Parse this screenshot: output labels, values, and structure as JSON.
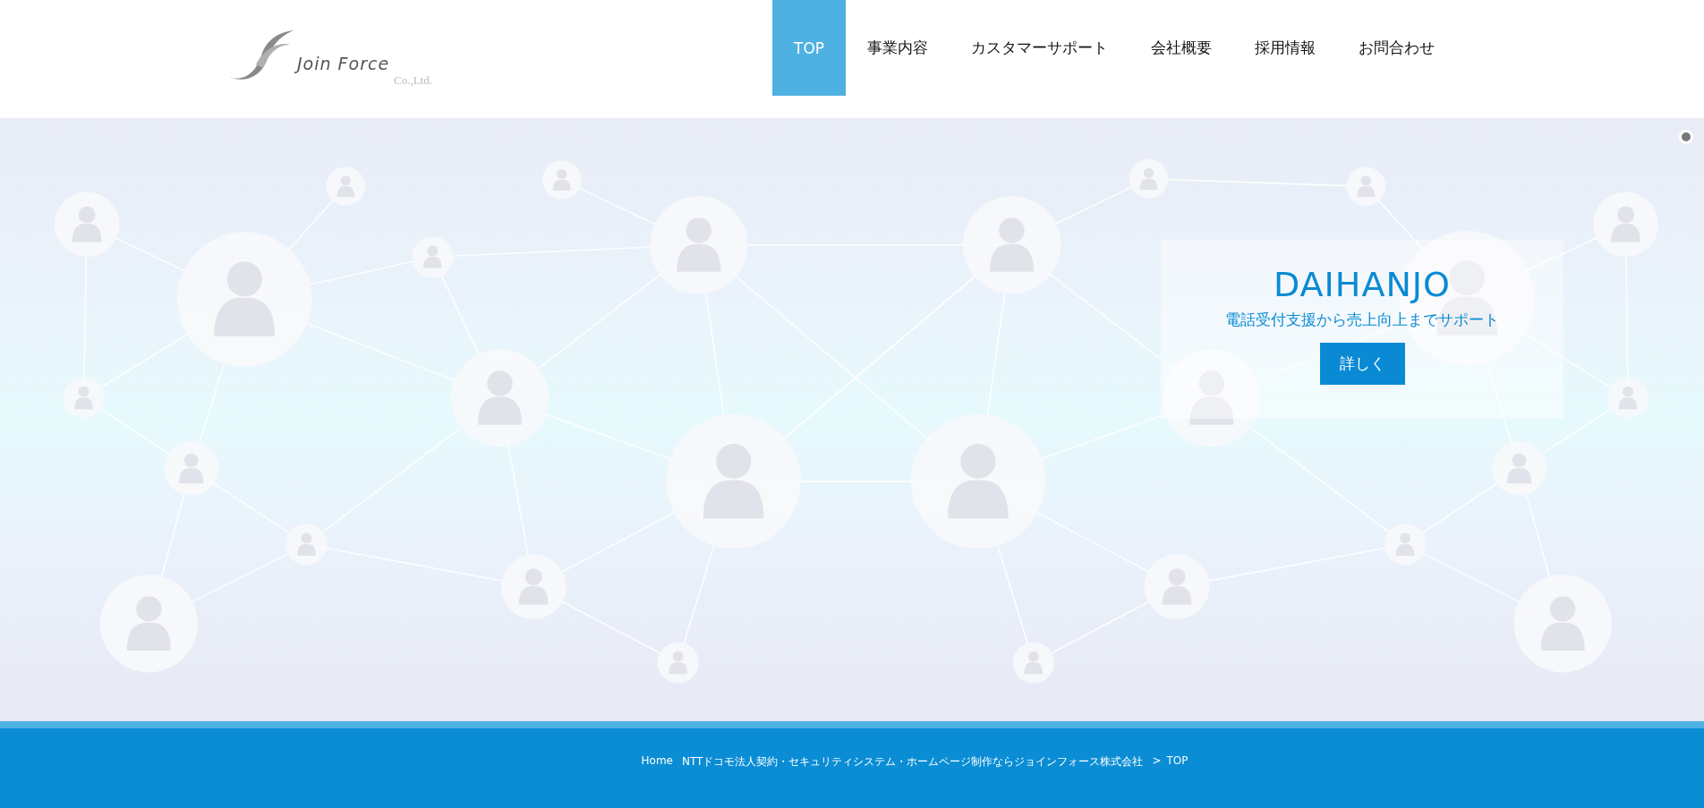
{
  "logo": {
    "name": "Join Force",
    "suffix": "Co.,Ltd."
  },
  "nav": [
    {
      "label": "TOP",
      "selected": true
    },
    {
      "label": "事業内容",
      "selected": false
    },
    {
      "label": "カスタマーサポート",
      "selected": false
    },
    {
      "label": "会社概要",
      "selected": false
    },
    {
      "label": "採用情報",
      "selected": false
    },
    {
      "label": "お問合わせ",
      "selected": false
    }
  ],
  "hero": {
    "title": "DAIHANJO",
    "subtitle": "電話受付支援から売上向上までサポート",
    "button": "詳しく"
  },
  "breadcrumb": [
    {
      "kind": "link",
      "text": "Home"
    },
    {
      "kind": "link",
      "text": "NTTドコモ法人契約・セキュリティシステム・ホームページ制作ならジョインフォース株式会社"
    },
    {
      "kind": "separator",
      "text": ">"
    },
    {
      "kind": "current",
      "text": "TOP"
    }
  ]
}
